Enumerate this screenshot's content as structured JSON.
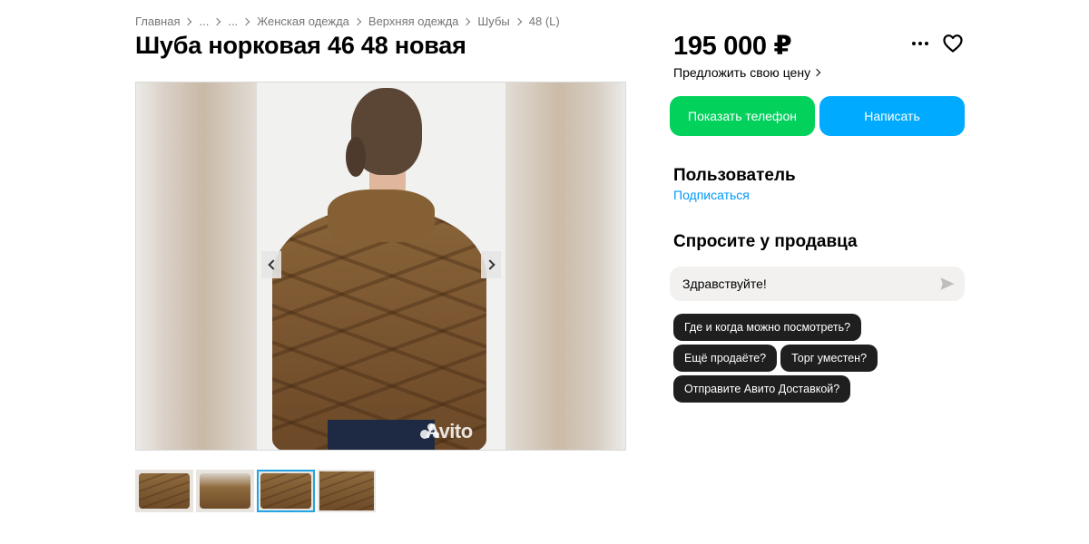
{
  "breadcrumb": [
    "Главная",
    "...",
    "...",
    "Женская одежда",
    "Верхняя одежда",
    "Шубы",
    "48 (L)"
  ],
  "title": "Шуба норковая 46 48 новая",
  "gallery": {
    "watermark": "Avito",
    "thumbnail_count": 4,
    "active_thumbnail": 3
  },
  "price": "195 000 ₽",
  "offer_link": "Предложить свою цену",
  "buttons": {
    "show_phone": "Показать телефон",
    "write": "Написать"
  },
  "seller": {
    "name": "Пользователь",
    "subscribe": "Подписаться"
  },
  "ask": {
    "title": "Спросите у продавца",
    "input_value": "Здравствуйте!",
    "chips": [
      "Где и когда можно посмотреть?",
      "Ещё продаёте?",
      "Торг уместен?",
      "Отправите Авито Доставкой?"
    ]
  },
  "colors": {
    "phone_button": "#02d15c",
    "write_button": "#00aaff",
    "link": "#0099f7",
    "active_thumb_border": "#22a4e6"
  },
  "icons": [
    "more-icon",
    "heart-icon",
    "send-icon",
    "chevron-left-icon",
    "chevron-right-icon"
  ]
}
